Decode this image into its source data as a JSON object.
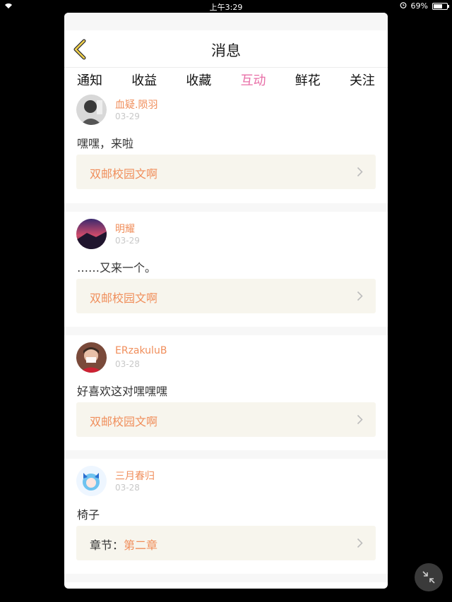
{
  "status": {
    "time": "上午3:29",
    "battery": "69%",
    "battery_level": 0.69
  },
  "header": {
    "title": "消息"
  },
  "tabs": [
    {
      "label": "通知"
    },
    {
      "label": "收益"
    },
    {
      "label": "收藏"
    },
    {
      "label": "互动",
      "active": true
    },
    {
      "label": "鲜花"
    },
    {
      "label": "关注"
    }
  ],
  "items": [
    {
      "user": "血疑.陨羽",
      "date": "03-29",
      "message": "嘿嘿，来啦",
      "ref": "双邮校园文啊"
    },
    {
      "user": "明耀",
      "date": "03-29",
      "message": "……又来一个。",
      "ref": "双邮校园文啊"
    },
    {
      "user": "ERzakuluB",
      "date": "03-28",
      "message": "好喜欢这对嘿嘿嘿",
      "ref": "双邮校园文啊"
    },
    {
      "user": "三月春归",
      "date": "03-28",
      "message": "椅子",
      "ref_label": "章节：",
      "ref": "第二章"
    }
  ],
  "colors": {
    "accent": "#e86fa7",
    "username": "#f08e5b",
    "ref_bg": "#f7f5ed"
  }
}
